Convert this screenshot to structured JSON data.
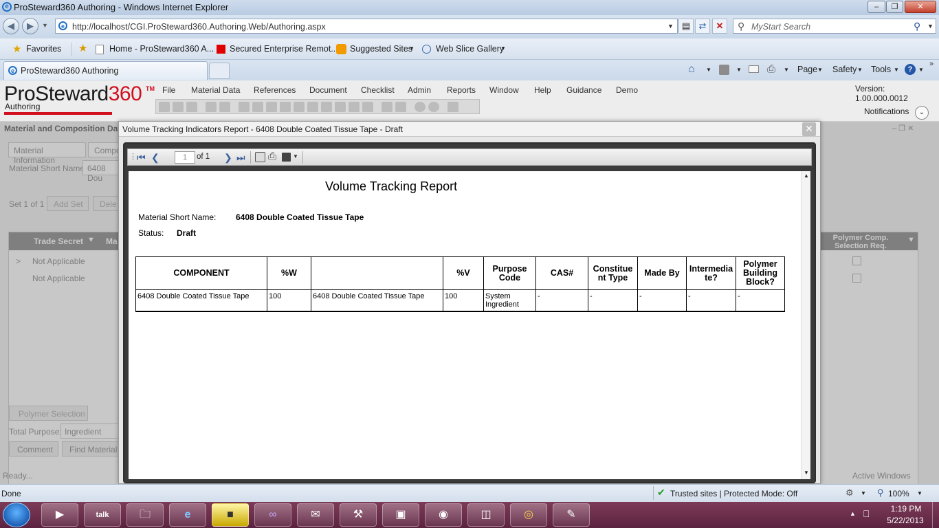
{
  "browser": {
    "window_title": "ProSteward360 Authoring - Windows Internet Explorer",
    "url": "http://localhost/CGI.ProSteward360.Authoring.Web/Authoring.aspx",
    "search_placeholder": "MyStart Search",
    "favorites_label": "Favorites",
    "favorites": [
      "Home - ProSteward360 A...",
      "Secured Enterprise Remot...",
      "Suggested Sites",
      "Web Slice Gallery"
    ],
    "tab_title": "ProSteward360 Authoring",
    "commands": [
      "Page",
      "Safety",
      "Tools"
    ],
    "status_left": "Done",
    "status_zone": "Trusted sites | Protected Mode: Off",
    "zoom": "100%"
  },
  "app": {
    "logo_main": "ProSteward",
    "logo_num": "360",
    "logo_tm": "TM",
    "logo_sub": "Authoring",
    "menu": [
      "File",
      "Material Data",
      "References",
      "Document",
      "Checklist",
      "Admin",
      "Reports",
      "Window",
      "Help",
      "Guidance",
      "Demo"
    ],
    "version": "Version: 1.00.000.0012",
    "notifications": "Notifications"
  },
  "background_panel": {
    "title": "Material and Composition Data",
    "tabs": [
      "Material Information",
      "Compo"
    ],
    "short_name_label": "Material Short Name:",
    "short_name_value": "6408 Dou",
    "set_label": "Set 1 of 1",
    "add_set": "Add Set",
    "delete": "Dele",
    "grid_header_trade": "Trade Secret",
    "grid_header_ma": "Ma",
    "rows": [
      "Not Applicable",
      "Not Applicable"
    ],
    "right_header": "Polymer Comp. Selection Req.",
    "polymer_selection": "Polymer Selection",
    "total_purpose_label": "Total Purpose:",
    "total_purpose_value": "Ingredient",
    "comment": "Comment",
    "find_material": "Find Material",
    "ready": "Ready...",
    "active_windows": "Active Windows"
  },
  "modal": {
    "title": "Volume Tracking Indicators Report - 6408 Double Coated Tissue Tape - Draft",
    "page_value": "1",
    "page_of": "of 1"
  },
  "report": {
    "heading": "Volume Tracking Report",
    "short_name_label": "Material Short Name:",
    "short_name_value": "6408 Double Coated Tissue Tape",
    "status_label": "Status:",
    "status_value": "Draft",
    "columns": [
      "COMPONENT",
      "%W",
      "",
      "%V",
      "Purpose Code",
      "CAS#",
      "Constitue nt Type",
      "Made By",
      "Intermedia te?",
      "Polymer Building Block?"
    ],
    "row": [
      "6408 Double Coated Tissue Tape",
      "100",
      "6408 Double Coated Tissue Tape",
      "100",
      "System Ingredient",
      "-",
      "-",
      "-",
      "-",
      "-"
    ]
  },
  "taskbar": {
    "time": "1:19 PM",
    "date": "5/22/2013"
  }
}
